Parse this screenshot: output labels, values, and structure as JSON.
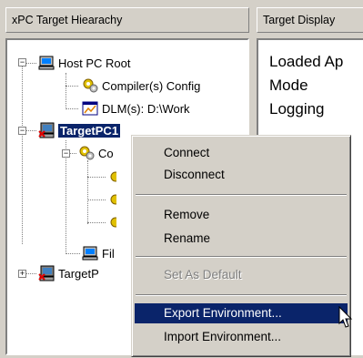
{
  "left_panel": {
    "header": "xPC Target Hiearachy",
    "tree": {
      "host_root": "Host PC Root",
      "compiler": "Compiler(s) Config",
      "dlm": "DLM(s): D:\\Work",
      "target1": "TargetPC1",
      "target1_child_prefix": "Co",
      "target1_fil": "Fil",
      "target2": "TargetP"
    }
  },
  "right_panel": {
    "header": "Target Display",
    "lines": [
      "Loaded Ap",
      "Mode",
      "Logging"
    ]
  },
  "context_menu": {
    "items": [
      {
        "label": "Connect",
        "enabled": true
      },
      {
        "label": "Disconnect",
        "enabled": true
      },
      {
        "label": "Remove",
        "enabled": true
      },
      {
        "label": "Rename",
        "enabled": true
      },
      {
        "label": "Set As Default",
        "enabled": false
      },
      {
        "label": "Export Environment...",
        "enabled": true,
        "highlighted": true
      },
      {
        "label": "Import Environment...",
        "enabled": true
      }
    ]
  },
  "colors": {
    "selection": "#0a246a",
    "panel_bg": "#d4d0c8",
    "disabled_text": "#808080"
  }
}
